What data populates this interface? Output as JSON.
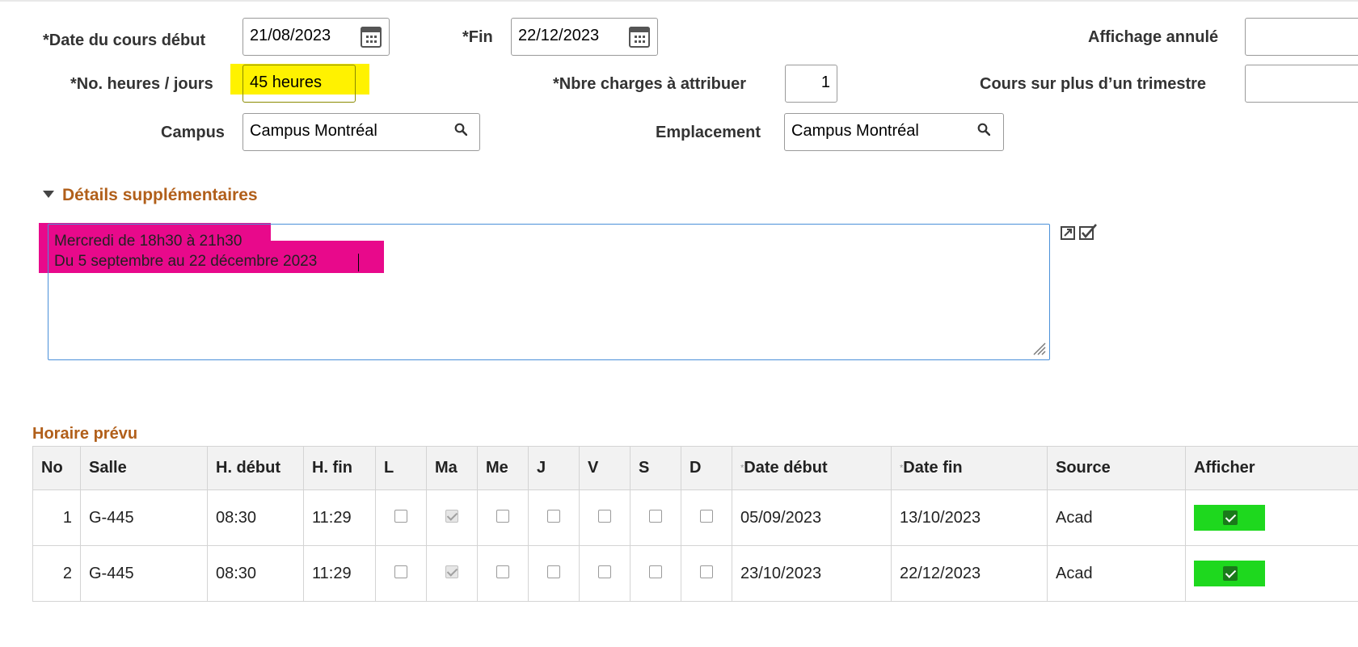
{
  "fields": {
    "date_debut_label": "*Date du cours début",
    "date_debut_value": "21/08/2023",
    "fin_label": "*Fin",
    "fin_value": "22/12/2023",
    "affichage_annule_label": "Affichage annulé",
    "heures_label": "*No. heures / jours",
    "heures_value": "45 heures",
    "charges_label": "*Nbre charges à attribuer",
    "charges_value": "1",
    "trimestre_label": "Cours sur plus d’un trimestre",
    "campus_label": "Campus",
    "campus_value": "Campus Montréal",
    "emplacement_label": "Emplacement",
    "emplacement_value": "Campus Montréal"
  },
  "details": {
    "title": "Détails supplémentaires",
    "line1": "Mercredi de 18h30 à 21h30",
    "line2": "Du 5 septembre au 22 décembre 2023"
  },
  "schedule": {
    "title": "Horaire prévu",
    "headers": {
      "no": "No",
      "salle": "Salle",
      "hdebut": "H. début",
      "hfin": "H. fin",
      "l": "L",
      "ma": "Ma",
      "me": "Me",
      "j": "J",
      "v": "V",
      "s": "S",
      "d": "D",
      "date_debut": "Date début",
      "date_fin": "Date fin",
      "source": "Source",
      "afficher": "Afficher"
    },
    "rows": [
      {
        "no": "1",
        "salle": "G-445",
        "hdebut": "08:30",
        "hfin": "11:29",
        "date_debut": "05/09/2023",
        "date_fin": "13/10/2023",
        "source": "Acad"
      },
      {
        "no": "2",
        "salle": "G-445",
        "hdebut": "08:30",
        "hfin": "11:29",
        "date_debut": "23/10/2023",
        "date_fin": "22/12/2023",
        "source": "Acad"
      }
    ]
  },
  "colors": {
    "highlight_yellow": "#fff200",
    "highlight_pink": "#e8098b",
    "section_title": "#b15f1a",
    "afficher_green": "#1ed81e"
  }
}
